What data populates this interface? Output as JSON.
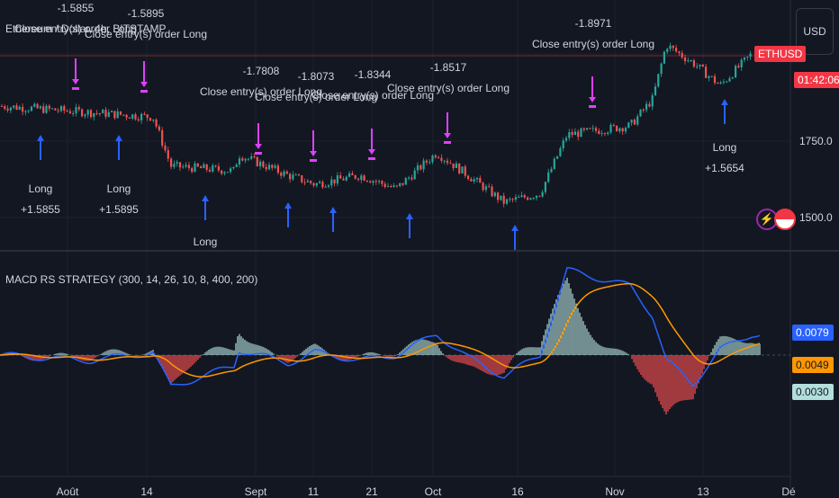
{
  "header": {
    "symbol_title": "Ethereum / Dollar, 4h, BITSTAMP",
    "currency": "USD"
  },
  "price_axis": {
    "ticks": [
      "1750.0",
      "1500.0"
    ],
    "last_symbol": "ETHUSD",
    "countdown": "01:42:06"
  },
  "indicator": {
    "title": "MACD RS STRATEGY (300, 14, 26, 10, 8, 400, 200)",
    "macd_value": "0.0079",
    "signal_value": "0.0049",
    "hist_value": "0.0030"
  },
  "time_axis": [
    "Août",
    "14",
    "Sept",
    "11",
    "21",
    "Oct",
    "16",
    "Nov",
    "13",
    "Dé"
  ],
  "trades": {
    "close_label": "Close entry(s) order Long",
    "closes": [
      "-1.5855",
      "-1.5895",
      "-1.7808",
      "-1.8073",
      "-1.8344",
      "-1.8517",
      "-1.8971"
    ],
    "long_label": "Long",
    "longs": [
      "+1.5855",
      "+1.5895",
      "+1.5654"
    ]
  },
  "colors": {
    "bg": "#131722",
    "up": "#26a69a",
    "down": "#ef5350",
    "macd": "#2962ff",
    "signal": "#ff9800",
    "hist_up": "#b2dfdb",
    "marker": "#e040fb",
    "long": "#2962ff"
  },
  "chart_data": {
    "type": "candlestick",
    "closes": [
      1865,
      1844,
      1829,
      1668,
      1653,
      1706,
      1638,
      1609,
      1638,
      1594,
      1712,
      1638,
      1550,
      1579,
      1771,
      1800,
      1888,
      2065,
      2006,
      1932,
      2035
    ],
    "macd": [
      0.0,
      -0.002,
      0.001,
      -0.012,
      -0.004,
      0.002,
      -0.003,
      0.001,
      -0.002,
      0.0,
      0.008,
      -0.001,
      -0.008,
      0.0,
      0.032,
      0.026,
      0.015,
      -0.002,
      -0.011,
      0.002,
      0.0079
    ]
  }
}
